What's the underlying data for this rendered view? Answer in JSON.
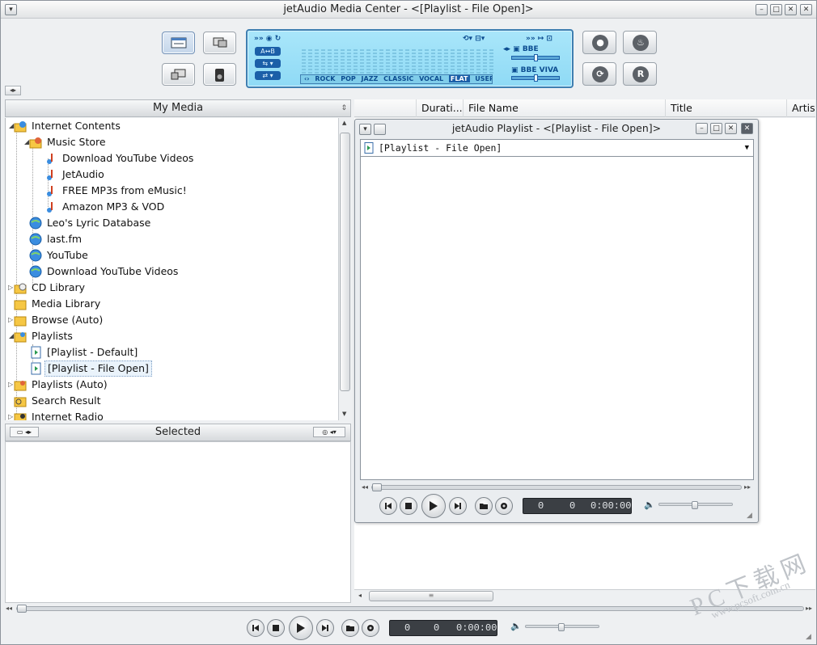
{
  "window": {
    "title": "jetAudio Media Center - <[Playlist - File Open]>"
  },
  "lcd": {
    "ab_label": "A↔B",
    "eq_presets": [
      "ROCK",
      "POP",
      "JAZZ",
      "CLASSIC",
      "VOCAL",
      "FLAT",
      "USER"
    ],
    "eq_selected": "FLAT",
    "bbe_label": "BBE",
    "bbe_viva_label": "BBE VIVA"
  },
  "left": {
    "my_media_header": "My Media",
    "selected_header": "Selected",
    "tree": [
      {
        "label": "Internet Contents",
        "icon": "internet-contents-icon"
      },
      {
        "label": "Music Store",
        "icon": "music-store-icon"
      },
      {
        "label": "Download YouTube Videos",
        "icon": "music-note-icon"
      },
      {
        "label": "JetAudio",
        "icon": "music-note-icon"
      },
      {
        "label": "FREE MP3s from eMusic!",
        "icon": "music-note-icon"
      },
      {
        "label": "Amazon MP3 & VOD",
        "icon": "music-note-icon"
      },
      {
        "label": "Leo's Lyric Database",
        "icon": "globe-icon"
      },
      {
        "label": "last.fm",
        "icon": "globe-icon"
      },
      {
        "label": "YouTube",
        "icon": "globe-icon"
      },
      {
        "label": "Download YouTube Videos",
        "icon": "globe-icon"
      },
      {
        "label": "CD Library",
        "icon": "cd-library-icon"
      },
      {
        "label": "Media Library",
        "icon": "folder-icon"
      },
      {
        "label": "Browse (Auto)",
        "icon": "folder-icon"
      },
      {
        "label": "Playlists",
        "icon": "playlists-icon"
      },
      {
        "label": "[Playlist - Default]",
        "icon": "playlist-file-icon"
      },
      {
        "label": "[Playlist - File Open]",
        "icon": "playlist-file-icon"
      },
      {
        "label": "Playlists (Auto)",
        "icon": "playlists-icon"
      },
      {
        "label": "Search Result",
        "icon": "search-folder-icon"
      },
      {
        "label": "Internet Radio",
        "icon": "radio-icon"
      }
    ]
  },
  "columns": [
    "Durati...",
    "File Name",
    "Title",
    "Artis"
  ],
  "playlist_window": {
    "title": "jetAudio Playlist - <[Playlist - File Open]>",
    "combo_value": "[Playlist - File Open]",
    "counter": {
      "track": "0",
      "index": "0",
      "time": "0:00:00"
    }
  },
  "main_player": {
    "counter": {
      "track": "0",
      "index": "0",
      "time": "0:00:00"
    },
    "position": 0,
    "volume": 0.5
  },
  "watermark": {
    "text_large": "PC下载网",
    "text_small": "www.pcsoft.com.cn"
  },
  "colors": {
    "lcd_bg": "#9fe1f8",
    "lcd_accent": "#1b5fa8",
    "selection": "#eaf3fb"
  }
}
